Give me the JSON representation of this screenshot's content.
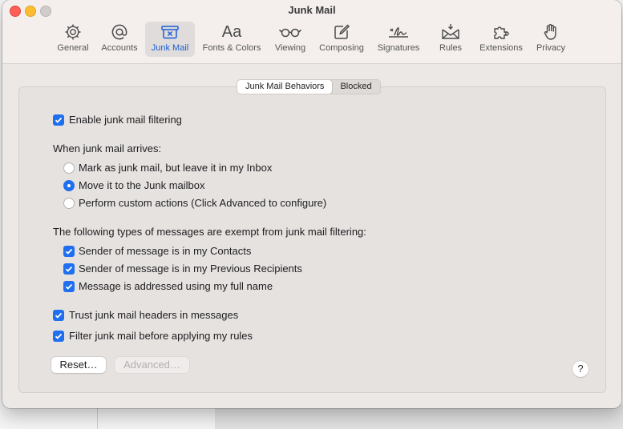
{
  "window": {
    "title": "Junk Mail"
  },
  "toolbar": {
    "items": [
      {
        "label": "General",
        "icon": "gear-icon"
      },
      {
        "label": "Accounts",
        "icon": "at-icon"
      },
      {
        "label": "Junk Mail",
        "icon": "junk-tray-icon",
        "active": true
      },
      {
        "label": "Fonts & Colors",
        "icon": "font-icon"
      },
      {
        "label": "Viewing",
        "icon": "glasses-icon"
      },
      {
        "label": "Composing",
        "icon": "compose-icon"
      },
      {
        "label": "Signatures",
        "icon": "signature-icon"
      },
      {
        "label": "Rules",
        "icon": "rules-icon"
      },
      {
        "label": "Extensions",
        "icon": "puzzle-icon"
      },
      {
        "label": "Privacy",
        "icon": "hand-icon"
      }
    ],
    "font_icon_glyph": "Aa"
  },
  "tabs": {
    "behaviors": "Junk Mail Behaviors",
    "blocked": "Blocked",
    "selected": "Junk Mail Behaviors"
  },
  "settings": {
    "enable_filtering": {
      "label": "Enable junk mail filtering",
      "checked": true
    },
    "arrives_heading": "When junk mail arrives:",
    "arrives_options": [
      {
        "label": "Mark as junk mail, but leave it in my Inbox",
        "selected": false
      },
      {
        "label": "Move it to the Junk mailbox",
        "selected": true
      },
      {
        "label": "Perform custom actions (Click Advanced to configure)",
        "selected": false
      }
    ],
    "exempt_heading": "The following types of messages are exempt from junk mail filtering:",
    "exempt_options": [
      {
        "label": "Sender of message is in my Contacts",
        "checked": true
      },
      {
        "label": "Sender of message is in my Previous Recipients",
        "checked": true
      },
      {
        "label": "Message is addressed using my full name",
        "checked": true
      }
    ],
    "trust_headers": {
      "label": "Trust junk mail headers in messages",
      "checked": true
    },
    "filter_before_rules": {
      "label": "Filter junk mail before applying my rules",
      "checked": true
    }
  },
  "buttons": {
    "reset": "Reset…",
    "advanced": "Advanced…",
    "help": "?"
  },
  "colors": {
    "accent": "#1f6ff0",
    "active_label": "#1a5fd6"
  }
}
